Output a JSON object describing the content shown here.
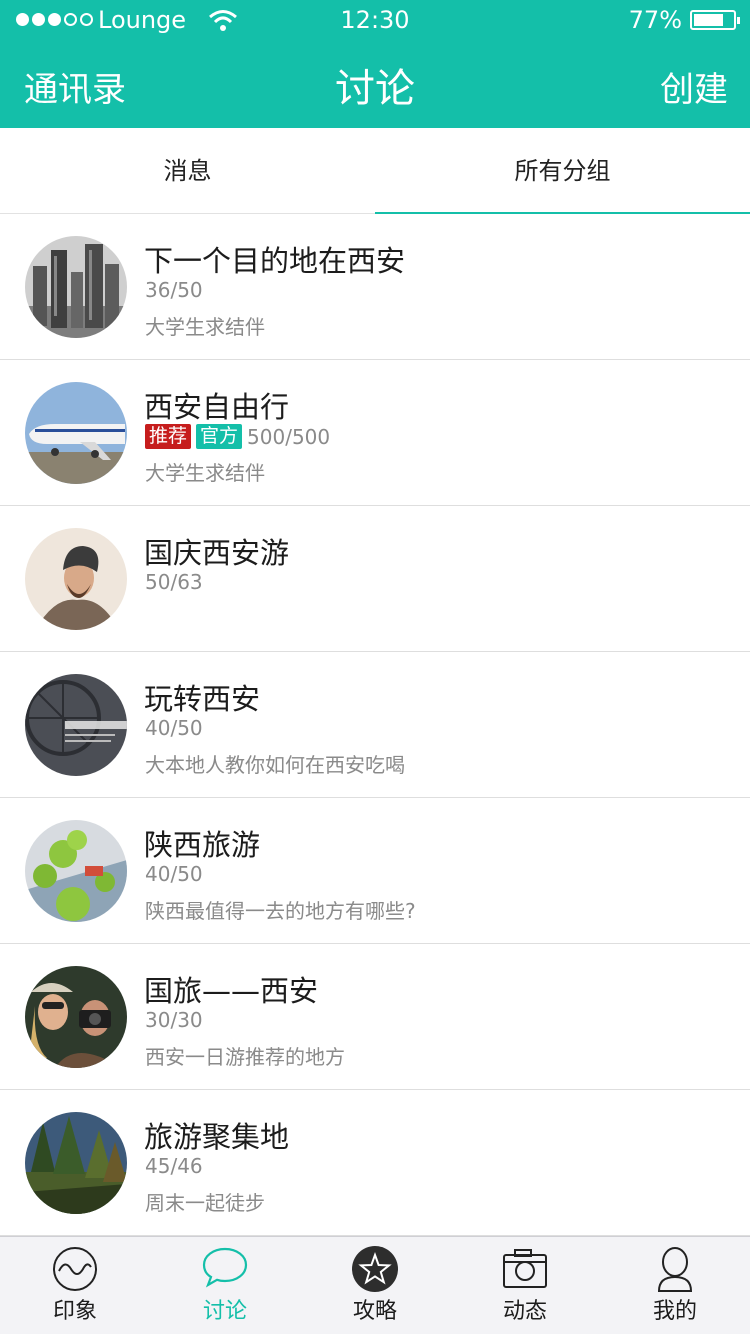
{
  "status_bar": {
    "carrier": "Lounge",
    "time": "12:30",
    "battery": "77%",
    "battery_level": 0.77,
    "signal_bars": 3
  },
  "nav": {
    "left": "通讯录",
    "title": "讨论",
    "right": "创建"
  },
  "tabs": [
    {
      "label": "消息",
      "active": false
    },
    {
      "label": "所有分组",
      "active": true
    }
  ],
  "groups": [
    {
      "name": "下一个目的地在西安",
      "count": "36/50",
      "desc": "大学生求结伴",
      "avatar": "city-skyline-avatar"
    },
    {
      "name": "西安自由行",
      "badges": [
        "推荐",
        "官方"
      ],
      "count": "500/500",
      "desc": "大学生求结伴",
      "avatar": "airplane-avatar"
    },
    {
      "name": "国庆西安游",
      "count": "50/63",
      "desc": "",
      "avatar": "bearded-man-avatar"
    },
    {
      "name": "玩转西安",
      "count": "40/50",
      "desc": "大本地人教你如何在西安吃喝",
      "avatar": "ferris-wheel-avatar"
    },
    {
      "name": "陕西旅游",
      "count": "40/50",
      "desc": "陕西最值得一去的地方有哪些?",
      "avatar": "toy-trees-avatar"
    },
    {
      "name": "国旅——西安",
      "count": "30/30",
      "desc": "西安一日游推荐的地方",
      "avatar": "photographers-avatar"
    },
    {
      "name": "旅游聚集地",
      "count": "45/46",
      "desc": "周末一起徒步",
      "avatar": "forest-avatar"
    }
  ],
  "tabbar": [
    {
      "label": "印象",
      "icon": "wave-circle-icon",
      "active": false
    },
    {
      "label": "讨论",
      "icon": "speech-bubble-icon",
      "active": true
    },
    {
      "label": "攻略",
      "icon": "star-icon",
      "active": false
    },
    {
      "label": "动态",
      "icon": "camera-icon",
      "active": false
    },
    {
      "label": "我的",
      "icon": "person-icon",
      "active": false
    }
  ],
  "colors": {
    "accent": "#14bfa9",
    "badge_recommend": "#c61d1d",
    "badge_official": "#14bfa9"
  }
}
